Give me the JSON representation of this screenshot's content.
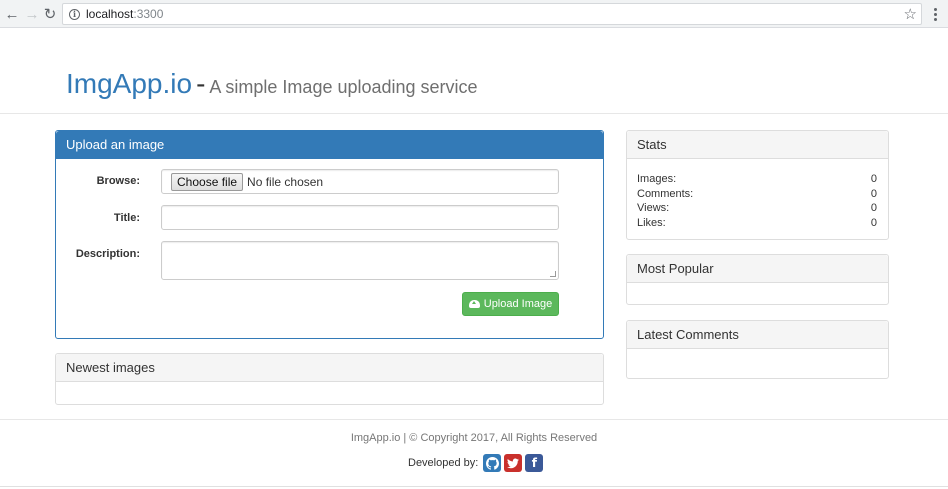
{
  "browser": {
    "url_host": "localhost",
    "url_port": ":3300"
  },
  "header": {
    "brand": "ImgApp.io",
    "separator": "-",
    "tagline": "A simple Image uploading service"
  },
  "upload_panel": {
    "title": "Upload an image",
    "browse_label": "Browse:",
    "choose_file_label": "Choose file",
    "file_status": "No file chosen",
    "title_label": "Title:",
    "title_value": "",
    "description_label": "Description:",
    "description_value": "",
    "submit_label": "Upload Image"
  },
  "newest_panel": {
    "title": "Newest images"
  },
  "stats_panel": {
    "title": "Stats",
    "rows": [
      {
        "label": "Images:",
        "value": "0"
      },
      {
        "label": "Comments:",
        "value": "0"
      },
      {
        "label": "Views:",
        "value": "0"
      },
      {
        "label": "Likes:",
        "value": "0"
      }
    ]
  },
  "popular_panel": {
    "title": "Most Popular"
  },
  "comments_panel": {
    "title": "Latest Comments"
  },
  "footer": {
    "copyright": "ImgApp.io | © Copyright 2017, All Rights Reserved",
    "developed_by": "Developed by:",
    "icons": [
      "github-icon",
      "twitter-icon",
      "facebook-icon"
    ]
  },
  "colors": {
    "brand_blue": "#337ab7",
    "success_green": "#5cb85c",
    "twitter_red": "#c9302c",
    "facebook_blue": "#3b5998"
  }
}
